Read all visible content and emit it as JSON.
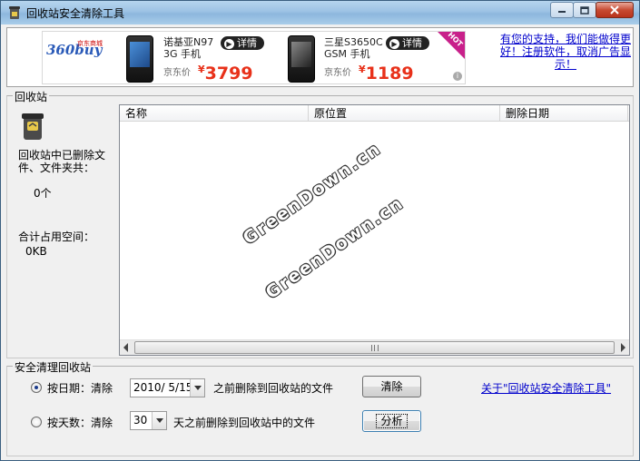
{
  "window": {
    "title": "回收站安全清除工具"
  },
  "ad": {
    "logo_main": "360buy",
    "logo_sub": "京东商城",
    "products": [
      {
        "name_line1": "诺基亚N97",
        "name_line2": "3G 手机",
        "price_label": "京东价",
        "currency": "¥",
        "price": "3799",
        "detail": "详情"
      },
      {
        "name_line1": "三星S3650C",
        "name_line2": "GSM 手机",
        "price_label": "京东价",
        "currency": "¥",
        "price": "1189",
        "detail": "详情"
      }
    ],
    "hot_badge": "HOT",
    "info_badge": "i",
    "support_link": "有您的支持，我们能做得更好！注册软件，取消广告显示！"
  },
  "recycle": {
    "group_title": "回收站",
    "deleted_label": "回收站中已删除文件、文件夹共：",
    "deleted_count": "0个",
    "space_label": "合计占用空间：",
    "space_value": "0KB",
    "columns": [
      "名称",
      "原位置",
      "删除日期"
    ],
    "watermark": [
      "GreenDown.cn",
      "GreenDown.cn"
    ]
  },
  "clean": {
    "group_title": "安全清理回收站",
    "by_date": {
      "label": "按日期：清除",
      "date_value": "2010/ 5/15",
      "suffix": "之前删除到回收站的文件",
      "button": "清除",
      "selected": true
    },
    "by_days": {
      "label": "按天数：清除",
      "days_value": "30",
      "suffix": "天之前删除到回收站中的文件",
      "button": "分析",
      "selected": false
    },
    "about_link": "关于\"回收站安全清除工具\""
  },
  "colors": {
    "accent_link": "#0000cc",
    "price_red": "#e8311a",
    "close_red": "#c74a32"
  }
}
